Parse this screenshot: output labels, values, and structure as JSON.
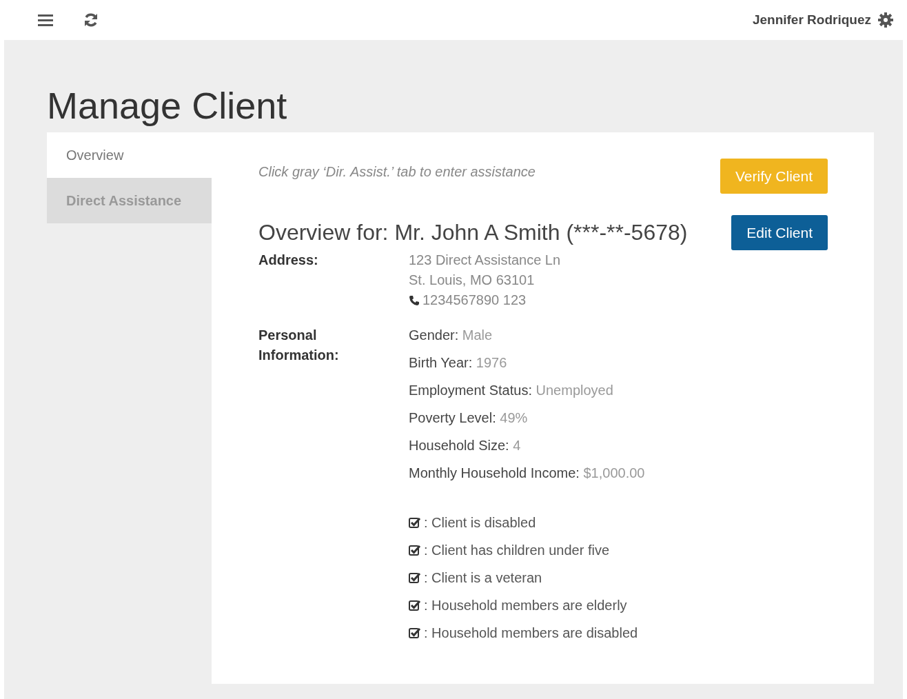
{
  "header": {
    "user_name": "Jennifer Rodriquez"
  },
  "page_title": "Manage Client",
  "tabs": [
    {
      "label": "Overview",
      "selected": true
    },
    {
      "label": "Direct Assistance",
      "selected": false
    }
  ],
  "hint": "Click gray ‘Dir. Assist.’ tab to enter assistance",
  "buttons": [
    {
      "label": "Verify Client",
      "kind": "warning"
    },
    {
      "label": "Edit Client",
      "kind": "primary"
    }
  ],
  "overview_title": "Overview for: Mr. John A Smith (***-**-5678)",
  "address": {
    "label": "Address:",
    "line_1": "123 Direct Assistance Ln",
    "line_2": "St. Louis, MO 63101",
    "phone": "1234567890 123"
  },
  "personal_information": {
    "label": "Personal Information:",
    "fields": [
      {
        "label": "Gender:",
        "value": "Male"
      },
      {
        "label": "Birth Year:",
        "value": "1976"
      },
      {
        "label": "Employment Status:",
        "value": "Unemployed"
      },
      {
        "label": "Poverty Level:",
        "value": "49%"
      },
      {
        "label": "Household Size:",
        "value": "4"
      },
      {
        "label": "Monthly Household Income:",
        "value": "$1,000.00"
      }
    ]
  },
  "flags": [
    {
      "label": ": Client is disabled",
      "checked": true
    },
    {
      "label": ": Client has children under five",
      "checked": true
    },
    {
      "label": ": Client is a veteran",
      "checked": true
    },
    {
      "label": ": Household members are elderly",
      "checked": true
    },
    {
      "label": ": Household members are disabled",
      "checked": true
    }
  ]
}
